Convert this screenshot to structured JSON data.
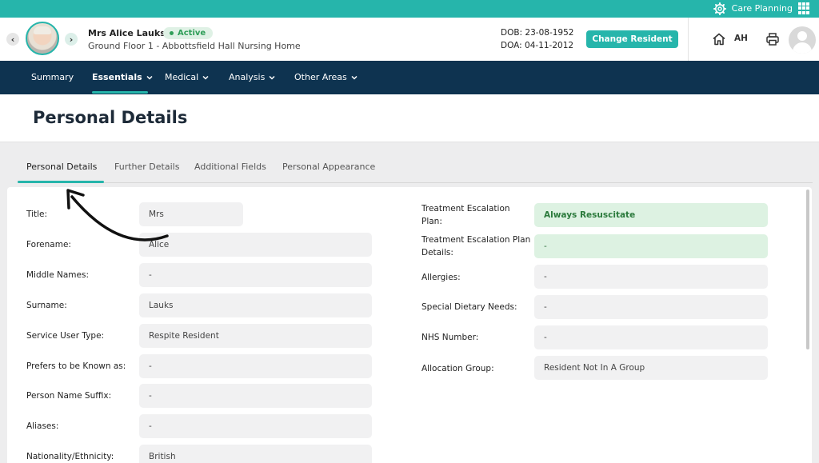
{
  "topbar": {
    "app_label": "Care Planning",
    "icons": [
      "gear-icon",
      "apps-grid-icon"
    ]
  },
  "resident": {
    "name": "Mrs Alice Lauks",
    "status": "Active",
    "location": "Ground Floor 1 - Abbottsfield Hall Nursing Home",
    "dob": "DOB: 23-08-1952",
    "doa": "DOA: 04-11-2012"
  },
  "header": {
    "change_resident": "Change Resident",
    "user_initials": "AH",
    "icons": [
      "chevron-left-icon",
      "chevron-right-icon",
      "home-icon",
      "printer-icon",
      "user-avatar-icon"
    ]
  },
  "nav": {
    "items": [
      {
        "label": "Summary",
        "dropdown": false
      },
      {
        "label": "Essentials",
        "dropdown": true,
        "active": true
      },
      {
        "label": "Medical",
        "dropdown": true
      },
      {
        "label": "Analysis",
        "dropdown": true
      },
      {
        "label": "Other Areas",
        "dropdown": true
      }
    ]
  },
  "page": {
    "title": "Personal Details"
  },
  "tabs": [
    "Personal Details",
    "Further Details",
    "Additional Fields",
    "Personal Appearance"
  ],
  "left_fields": [
    {
      "label": "Title:",
      "value": "Mrs"
    },
    {
      "label": "Forename:",
      "value": "Alice"
    },
    {
      "label": "Middle Names:",
      "value": "-"
    },
    {
      "label": "Surname:",
      "value": "Lauks"
    },
    {
      "label": "Service User Type:",
      "value": "Respite Resident"
    },
    {
      "label": "Prefers to be Known as:",
      "value": "-"
    },
    {
      "label": "Person Name Suffix:",
      "value": "-"
    },
    {
      "label": "Aliases:",
      "value": "-"
    },
    {
      "label": "Nationality/Ethnicity:",
      "value": "British"
    }
  ],
  "right_fields": [
    {
      "label": "Treatment Escalation Plan:",
      "value": "Always Resuscitate"
    },
    {
      "label": "Treatment Escalation Plan Details:",
      "value": "-"
    },
    {
      "label": "Allergies:",
      "value": "-"
    },
    {
      "label": "Special Dietary Needs:",
      "value": "-"
    },
    {
      "label": "NHS Number:",
      "value": "-"
    },
    {
      "label": "Allocation Group:",
      "value": "Resident Not In A Group"
    }
  ],
  "colors": {
    "accent": "#26b5ab",
    "nav_bg": "#0e3350",
    "status_green": "#2f9e58",
    "highlight_field": "#ddf2e2"
  }
}
